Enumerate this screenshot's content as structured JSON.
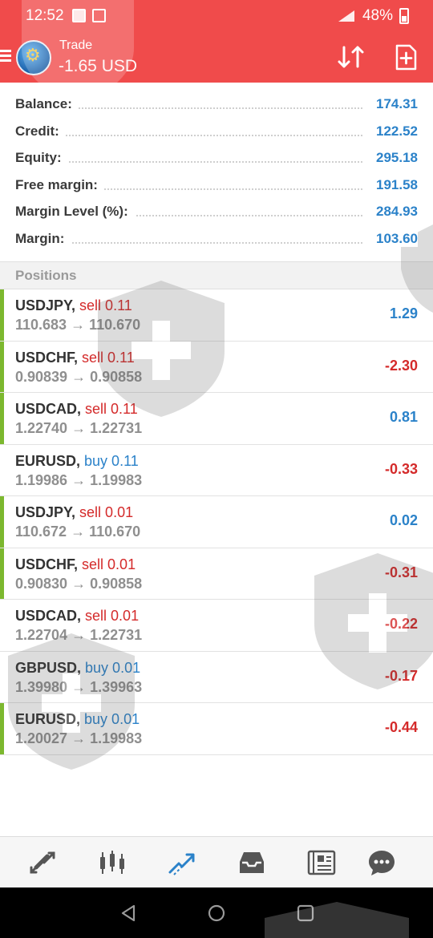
{
  "status_bar": {
    "time": "12:52",
    "battery_percent": "48%"
  },
  "header": {
    "title": "Trade",
    "profit": "-1.65 USD"
  },
  "account": [
    {
      "label": "Balance:",
      "value": "174.31"
    },
    {
      "label": "Credit:",
      "value": "122.52"
    },
    {
      "label": "Equity:",
      "value": "295.18"
    },
    {
      "label": "Free margin:",
      "value": "191.58"
    },
    {
      "label": "Margin Level (%):",
      "value": "284.93"
    },
    {
      "label": "Margin:",
      "value": "103.60"
    }
  ],
  "positions_header": "Positions",
  "positions": [
    {
      "symbol": "USDJPY",
      "side": "sell 0.11",
      "prices": "110.683 → 110.670",
      "profit": "1.29"
    },
    {
      "symbol": "USDCHF",
      "side": "sell 0.11",
      "prices": "0.90839 → 0.90858",
      "profit": "-2.30"
    },
    {
      "symbol": "USDCAD",
      "side": "sell 0.11",
      "prices": "1.22740 → 1.22731",
      "profit": "0.81"
    },
    {
      "symbol": "EURUSD",
      "side": "buy 0.11",
      "prices": "1.19986 → 1.19983",
      "profit": "-0.33"
    },
    {
      "symbol": "USDJPY",
      "side": "sell 0.01",
      "prices": "110.672 → 110.670",
      "profit": "0.02"
    },
    {
      "symbol": "USDCHF",
      "side": "sell 0.01",
      "prices": "0.90830 → 0.90858",
      "profit": "-0.31"
    },
    {
      "symbol": "USDCAD",
      "side": "sell 0.01",
      "prices": "1.22704 → 1.22731",
      "profit": "-0.22"
    },
    {
      "symbol": "GBPUSD",
      "side": "buy 0.01",
      "prices": "1.39980 → 1.39963",
      "profit": "-0.17"
    },
    {
      "symbol": "EURUSD",
      "side": "buy 0.01",
      "prices": "1.20027 → 1.19983",
      "profit": "-0.44"
    }
  ],
  "colors": {
    "header_bg": "#f04b4b",
    "positive": "#2b82c9",
    "negative": "#d42a2a",
    "row_marker": "#7cb82f",
    "tab_active": "#2b82c9"
  },
  "tabs": [
    {
      "icon": "quotes-icon",
      "active": false
    },
    {
      "icon": "chart-icon",
      "active": false
    },
    {
      "icon": "trade-icon",
      "active": true
    },
    {
      "icon": "history-icon",
      "active": false
    },
    {
      "icon": "news-icon",
      "active": false
    },
    {
      "icon": "chat-icon",
      "active": false
    }
  ]
}
